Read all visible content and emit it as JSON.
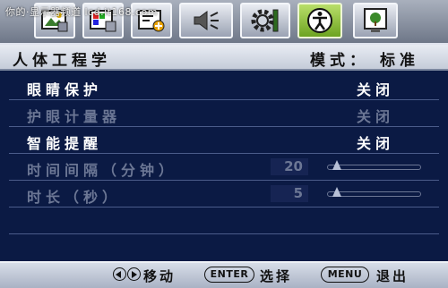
{
  "watermark": "你的‧显示器频道 lcd.it168.com",
  "tabs": [
    {
      "name": "picture-tab",
      "icon": "picture-icon",
      "active": false
    },
    {
      "name": "color-tab",
      "icon": "color-adjust-icon",
      "active": false
    },
    {
      "name": "input-tab",
      "icon": "input-source-icon",
      "active": false
    },
    {
      "name": "audio-tab",
      "icon": "speaker-icon",
      "active": false
    },
    {
      "name": "system-tab",
      "icon": "gear-icon",
      "active": false
    },
    {
      "name": "ergonomics-tab",
      "icon": "ergonomics-icon",
      "active": true
    },
    {
      "name": "eco-tab",
      "icon": "eco-plant-icon",
      "active": false
    }
  ],
  "header": {
    "title": "人体工程学",
    "mode_label": "模式：",
    "mode_value": "标准"
  },
  "menu": {
    "items": [
      {
        "label": "眼睛保护",
        "value": "关闭",
        "enabled": true
      },
      {
        "label": "护眼计量器",
        "value": "关闭",
        "enabled": false
      },
      {
        "label": "智能提醒",
        "value": "关闭",
        "enabled": true
      },
      {
        "label": "时间间隔（分钟）",
        "value": "20",
        "enabled": false,
        "slider_fraction": 0.0
      },
      {
        "label": "时长（秒）",
        "value": "5",
        "enabled": false,
        "slider_fraction": 0.0
      }
    ]
  },
  "footer": {
    "move_label": "移动",
    "enter_key": "ENTER",
    "select_label": "选择",
    "menu_key": "MENU",
    "exit_label": "退出"
  },
  "colors": {
    "background": "#0b1a44",
    "active_tab": "#8cc63f",
    "enabled_text": "#ffffff",
    "disabled_text": "#6c7795"
  }
}
